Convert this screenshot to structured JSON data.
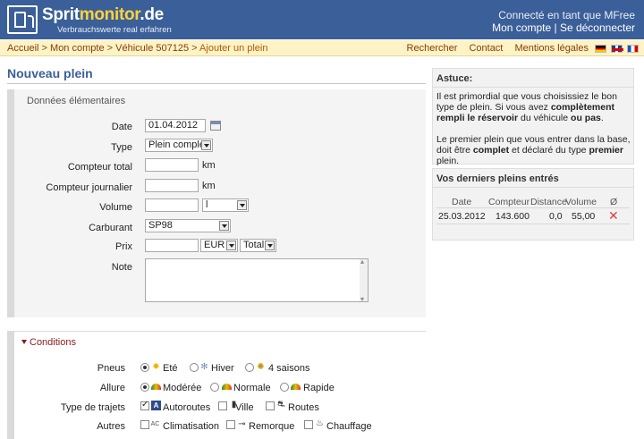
{
  "header": {
    "brand_main": "Sprit",
    "brand_accent": "monitor",
    "brand_tld": ".de",
    "tagline": "Verbrauchswerte real erfahren",
    "logged_in": "Connecté en tant que MFree",
    "my_account": "Mon compte",
    "separator": "|",
    "logout": "Se déconnecter"
  },
  "breadcrumb": {
    "home": "Accueil",
    "sep": ">",
    "account": "Mon compte",
    "vehicle": "Véhicule 507125",
    "current": "Ajouter un plein"
  },
  "toplinks": {
    "search": "Rechercher",
    "contact": "Contact",
    "legal": "Mentions légales"
  },
  "page": {
    "title": "Nouveau plein"
  },
  "basic": {
    "heading": "Données élémentaires",
    "date_label": "Date",
    "date_value": "01.04.2012",
    "type_label": "Type",
    "type_value": "Plein complet",
    "odometer_label": "Compteur total",
    "odometer_value": "",
    "odometer_unit": "km",
    "trip_label": "Compteur journalier",
    "trip_value": "",
    "trip_unit": "km",
    "volume_label": "Volume",
    "volume_value": "",
    "volume_unit": "l",
    "fuel_label": "Carburant",
    "fuel_value": "SP98",
    "price_label": "Prix",
    "price_value": "",
    "currency_value": "EUR",
    "price_mode_value": "Total",
    "note_label": "Note"
  },
  "conditions": {
    "heading": "Conditions",
    "tyres_label": "Pneus",
    "tyres_options": [
      "Eté",
      "Hiver",
      "4 saisons"
    ],
    "tyres_selected": "Eté",
    "style_label": "Allure",
    "style_options": [
      "Modérée",
      "Normale",
      "Rapide"
    ],
    "style_selected": "Modérée",
    "trips_label": "Type de trajets",
    "trips_options": [
      "Autoroutes",
      "Ville",
      "Routes"
    ],
    "trips_checked": [
      "Autoroutes"
    ],
    "other_label": "Autres",
    "other_options": [
      "Climatisation",
      "Remorque",
      "Chauffage"
    ],
    "ac_icon_text": "AC"
  },
  "tip": {
    "title": "Astuce:",
    "p1_a": "Il est primordial que vous choisissiez le bon type de plein. Si vous avez ",
    "p1_b": "complètement rempli le réservoir",
    "p1_c": " du véhicule ",
    "p1_d": "ou pas",
    "p1_e": ".",
    "p2_a": "Le premier plein que vous entrer dans la base, doit être ",
    "p2_b": "complet",
    "p2_c": " et déclaré du type ",
    "p2_d": "premier",
    "p2_e": " plein."
  },
  "last_entries": {
    "title": "Vos derniers pleins entrés",
    "columns": [
      "Date",
      "Compteur",
      "Distance",
      "Volume",
      "Ø"
    ],
    "rows": [
      {
        "date": "25.03.2012",
        "odometer": "143.600",
        "distance": "0,0",
        "volume": "55,00",
        "avg": ""
      }
    ]
  },
  "colors": {
    "header_bg": "#3b5f98",
    "brand_accent": "#ffd23a",
    "crumb_bg": "#fdf3c7",
    "title": "#3b5f98",
    "delete": "#e04040"
  }
}
